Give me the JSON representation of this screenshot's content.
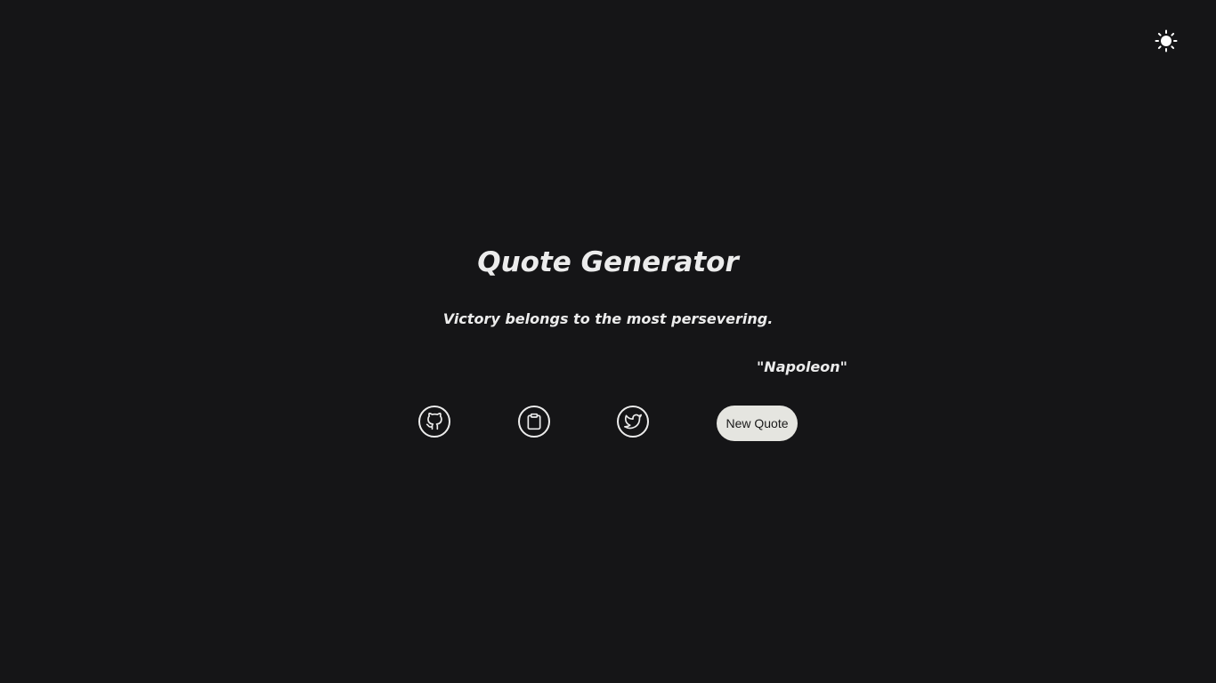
{
  "header": {
    "theme_toggle_icon": "sun-icon"
  },
  "main": {
    "title": "Quote Generator",
    "quote": "Victory belongs to the most persevering.",
    "author": "\"Napoleon\""
  },
  "actions": {
    "github_icon": "github-icon",
    "copy_icon": "clipboard-icon",
    "twitter_icon": "twitter-icon",
    "new_quote_label": "New Quote"
  },
  "colors": {
    "background": "#151517",
    "text": "#ececec",
    "button_bg": "#e5e5e0"
  }
}
